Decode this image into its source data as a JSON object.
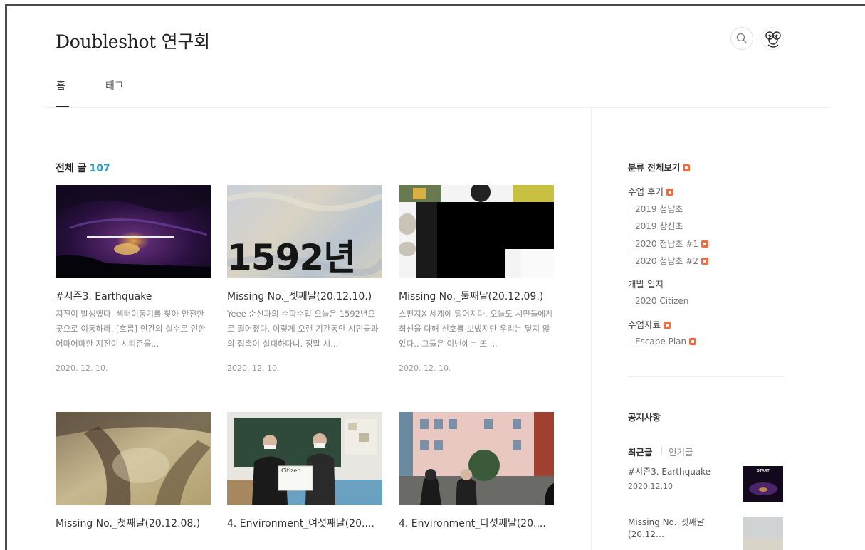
{
  "header": {
    "site_title": "Doubleshot 연구회",
    "tabs": [
      {
        "label": "홈"
      },
      {
        "label": "태그"
      }
    ],
    "search_icon": "search-icon",
    "avatar_icon": "avatar"
  },
  "posts_section": {
    "label": "전체 글",
    "count": "107"
  },
  "posts": [
    {
      "title": "#시즌3. Earthquake",
      "excerpt": "지진이 발생했다. 섹터이동기를 찾아 안전한 곳으로 이동하라. [흐름] 인간의 실수로 인한 어마어마한 지진이 시티즌을...",
      "date": "2020. 12. 10."
    },
    {
      "title": "Missing No._셋째날(20.12.10.)",
      "excerpt": "Yeee 순신과의 수학수업 오늘은 1592년으로 떨어졌다. 이렇게 오랜 기간동안 시민들과의 접촉이 실패하다니. 정말 시...",
      "date": "2020. 12. 10.",
      "thumb_text": "1592년"
    },
    {
      "title": "Missing No._둘째날(20.12.09.)",
      "excerpt": "스펀지X 세계에 떨어지다. 오늘도 시민들에게 최선을 다해 신호를 보냈지만 우리는 닿지 않았다.. 그들은 이번에는 또 ...",
      "date": "2020. 12. 10."
    },
    {
      "title": "Missing No._첫째날(20.12.08.)",
      "excerpt": "",
      "date": ""
    },
    {
      "title": "4. Environment_여섯째날(20....",
      "excerpt": "",
      "date": "",
      "thumb_text": "Citizen"
    },
    {
      "title": "4. Environment_다섯째날(20....",
      "excerpt": "",
      "date": ""
    }
  ],
  "sidebar": {
    "category_all": "분류 전체보기",
    "categories": [
      {
        "label": "수업 후기",
        "subs": [
          "2019 청남초",
          "2019 창신초",
          "2020 청남초 #1",
          "2020 청남초 #2"
        ]
      },
      {
        "label": "개발 일지",
        "subs": [
          "2020 Citizen"
        ]
      },
      {
        "label": "수업자료",
        "subs": [
          "Escape Plan"
        ]
      }
    ],
    "notice_title": "공지사항",
    "recent_tabs": [
      "최근글",
      "인기글"
    ],
    "recent_posts": [
      {
        "title": "#시즌3. Earthquake",
        "date": "2020.12.10",
        "thumb_text": "START"
      },
      {
        "title": "Missing No._셋째날(20.12…",
        "date": ""
      }
    ]
  },
  "colors": {
    "accent_count": "#2a9fc5",
    "badge": "#f06b3f"
  }
}
